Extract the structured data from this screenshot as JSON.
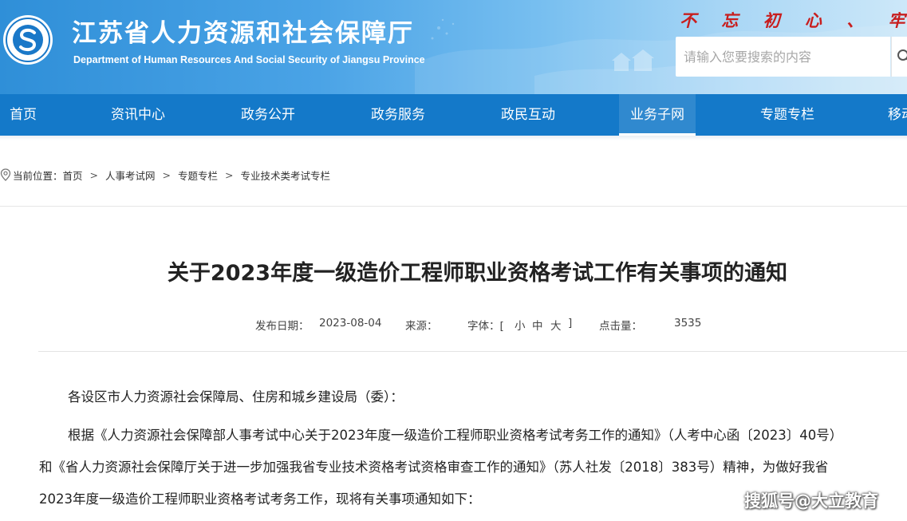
{
  "header": {
    "site_title": "江苏省人力资源和社会保障厅",
    "site_subtitle": "Department of Human Resources And Social Security of Jiangsu Province",
    "slogan": "不 忘 初 心 、 牢 记",
    "search_placeholder": "请输入您要搜索的内容"
  },
  "nav": {
    "items": [
      {
        "label": "首页"
      },
      {
        "label": "资讯中心"
      },
      {
        "label": "政务公开"
      },
      {
        "label": "政务服务"
      },
      {
        "label": "政民互动"
      },
      {
        "label": "业务子网",
        "active": true
      },
      {
        "label": "专题专栏"
      },
      {
        "label": "移动"
      }
    ]
  },
  "breadcrumb": {
    "prefix": "当前位置：",
    "items": [
      "首页",
      "人事考试网",
      "专题专栏",
      "专业技术类考试专栏"
    ],
    "separator": ">"
  },
  "article": {
    "title": "关于2023年度一级造价工程师职业资格考试工作有关事项的通知",
    "meta": {
      "date_label": "发布日期：",
      "date": "2023-08-04",
      "source_label": "来源：",
      "font_label": "字体：[",
      "font_small": "小",
      "font_medium": "中",
      "font_large": "大",
      "font_close": "]",
      "clicks_label": "点击量：",
      "clicks": "3535"
    },
    "salutation": "各设区市人力资源社会保障局、住房和城乡建设局（委）：",
    "para1_line1": "根据《人力资源社会保障部人事考试中心关于2023年度一级造价工程师职业资格考试考务工作的通知》（人考中心函〔2023〕40号）",
    "para1_line2": "和《省人力资源社会保障厅关于进一步加强我省专业技术资格考试资格审查工作的通知》（苏人社发〔2018〕383号）精神，为做好我省",
    "para1_line3": "2023年度一级造价工程师职业资格考试考务工作，现将有关事项通知如下："
  },
  "watermark": "搜狐号@大立教育",
  "colors": {
    "nav_bg": "#1479c9",
    "header_blue": "#2f8fd8",
    "slogan_red": "#c81e1e"
  },
  "icons": {
    "logo": "department-seal-logo",
    "search": "search-icon",
    "breadcrumb": "location-pin-icon"
  }
}
